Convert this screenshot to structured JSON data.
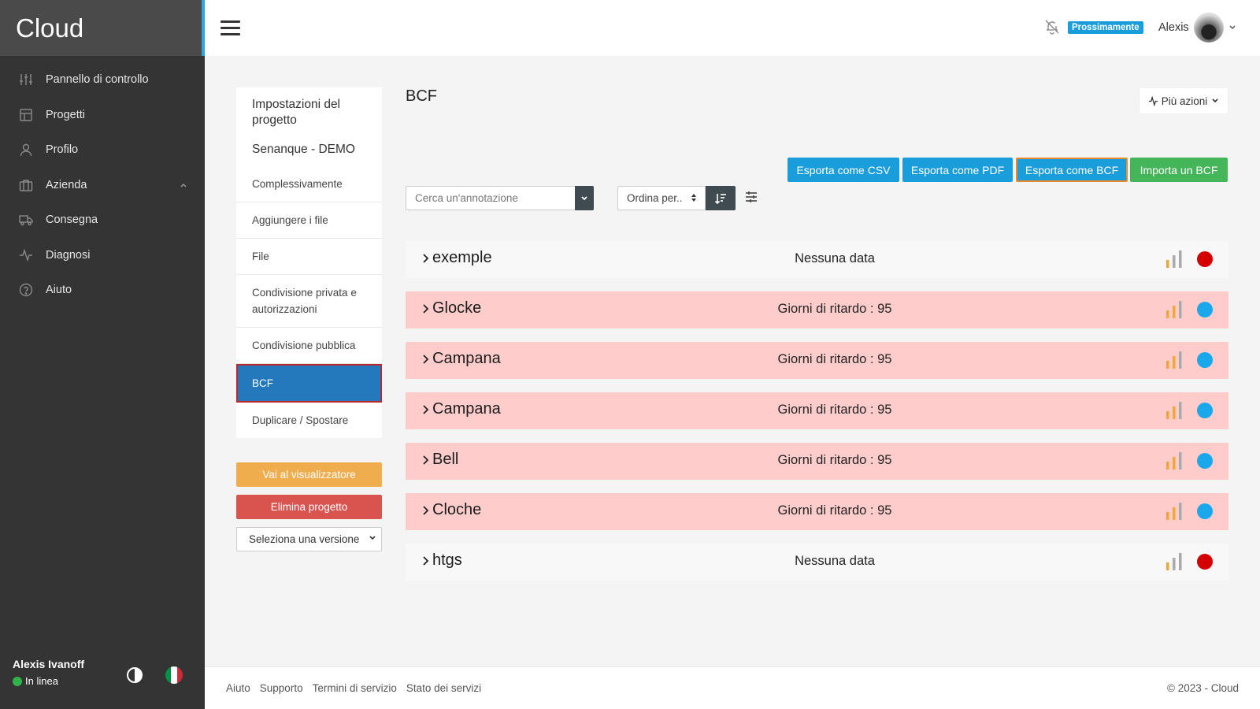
{
  "app": {
    "brand": "Cloud"
  },
  "sidebar": {
    "items": [
      {
        "label": "Pannello di controllo",
        "icon": "sliders-icon"
      },
      {
        "label": "Progetti",
        "icon": "layout-icon"
      },
      {
        "label": "Profilo",
        "icon": "user-icon"
      },
      {
        "label": "Azienda",
        "icon": "briefcase-icon",
        "expandable": true
      },
      {
        "label": "Consegna",
        "icon": "truck-icon"
      },
      {
        "label": "Diagnosi",
        "icon": "activity-icon"
      },
      {
        "label": "Aiuto",
        "icon": "help-circle-icon"
      }
    ],
    "user_name": "Alexis Ivanoff",
    "user_status": "In linea"
  },
  "topbar": {
    "badge": "Prossimamente",
    "user": "Alexis"
  },
  "settings": {
    "title": "Impostazioni del progetto",
    "project": "Senanque - DEMO",
    "items": [
      "Complessivamente",
      "Aggiungere i file",
      "File",
      "Condivisione privata e autorizzazioni",
      "Condivisione pubblica",
      "BCF",
      "Duplicare / Spostare"
    ],
    "active_index": 5,
    "viewer_button": "Vai al visualizzatore",
    "delete_button": "Elimina progetto",
    "version_placeholder": "Seleziona una versione"
  },
  "main": {
    "title": "BCF",
    "more_actions": "Più azioni",
    "export_csv": "Esporta come CSV",
    "export_pdf": "Esporta come PDF",
    "export_bcf": "Esporta come BCF",
    "import_bcf": "Importa un BCF",
    "search_placeholder": "Cerca un'annotazione",
    "sort_label": "Ordina per..",
    "rows": [
      {
        "name": "exemple",
        "status": "Nessuna data",
        "style": "white",
        "circle": "#d40000"
      },
      {
        "name": "Glocke",
        "status": "Giorni di ritardo : 95",
        "style": "pink",
        "circle": "#1aa7ec"
      },
      {
        "name": "Campana",
        "status": "Giorni di ritardo : 95",
        "style": "pink",
        "circle": "#1aa7ec"
      },
      {
        "name": "Campana",
        "status": "Giorni di ritardo : 95",
        "style": "pink",
        "circle": "#1aa7ec"
      },
      {
        "name": "Bell",
        "status": "Giorni di ritardo : 95",
        "style": "pink",
        "circle": "#1aa7ec"
      },
      {
        "name": "Cloche",
        "status": "Giorni di ritardo : 95",
        "style": "pink",
        "circle": "#1aa7ec"
      },
      {
        "name": "htgs",
        "status": "Nessuna data",
        "style": "white",
        "circle": "#d40000"
      }
    ]
  },
  "footer": {
    "links": [
      "Aiuto",
      "Supporto",
      "Termini di servizio",
      "Stato dei servizi"
    ],
    "copyright": "© 2023 - Cloud"
  },
  "colors": {
    "accent": "#1a9ddb",
    "success": "#45b55a",
    "warning": "#f0ad4e",
    "danger": "#d9534f",
    "active_nav": "#2479bd"
  }
}
